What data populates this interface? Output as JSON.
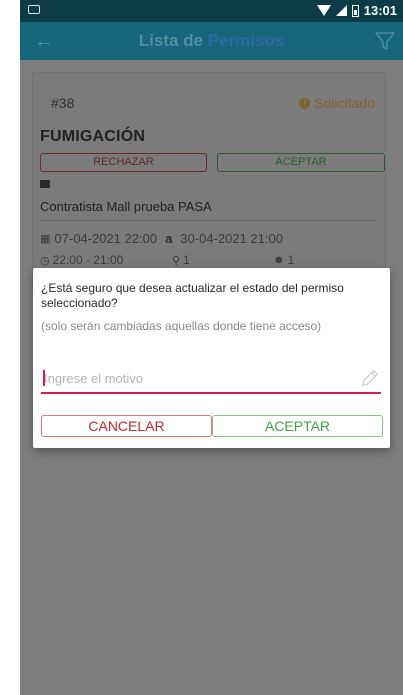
{
  "status_bar": {
    "time": "13:01"
  },
  "toolbar": {
    "title_part1": "Lista de",
    "title_part2": "Permisos"
  },
  "card": {
    "number": "#38",
    "status": "Solicitado",
    "title": "FUMIGACIÓN",
    "reject_label": "RECHAZAR",
    "accept_label": "ACEPTAR",
    "contractor": "Contratista Mall prueba PASA",
    "date_start": "07-04-2021 22:00",
    "date_sep": "a",
    "date_end": "30-04-2021 21:00",
    "time_range": "22:00 - 21:00",
    "locations": "1",
    "people": "1"
  },
  "dialog": {
    "question": "¿Está seguro que desea actualizar el estado del permiso seleccionado?",
    "note": "(solo serán cambiadas aquellas donde tiene acceso)",
    "reason_placeholder": "Ingrese el motivo",
    "cancel_label": "CANCELAR",
    "accept_label": "ACEPTAR"
  },
  "colors": {
    "toolbar": "#16677a",
    "status_bar": "#0c3c47",
    "accent": "#d81b60",
    "cancel": "#c62828",
    "accept": "#43a047"
  }
}
